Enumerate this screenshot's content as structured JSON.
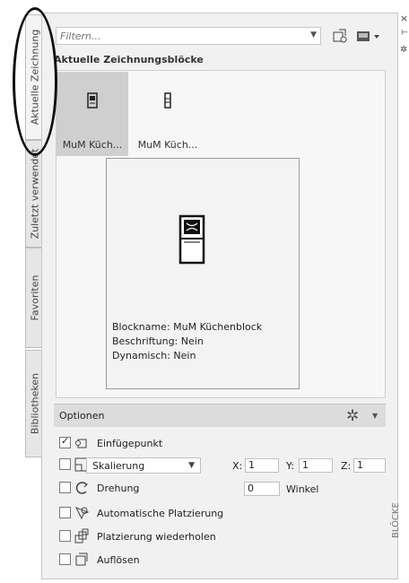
{
  "tabs": [
    {
      "label": "Aktuelle Zeichnung"
    },
    {
      "label": "Zuletzt verwendet"
    },
    {
      "label": "Favoriten"
    },
    {
      "label": "Bibliotheken"
    }
  ],
  "side_strip": {
    "label": "BLÖCKE"
  },
  "filter": {
    "placeholder": "Filtern..."
  },
  "section_title": "Aktuelle Zeichnungsblöcke",
  "blocks": [
    {
      "label": "MuM Küch..."
    },
    {
      "label": "MuM Küch..."
    }
  ],
  "preview": {
    "name_line": "Blockname: MuM Küchenblock",
    "annotative_line": "Beschriftung: Nein",
    "dynamic_line": "Dynamisch: Nein"
  },
  "options": {
    "title": "Optionen",
    "insertion_point": {
      "label": "Einfügepunkt",
      "checked": true
    },
    "scale": {
      "label": "Skalierung",
      "x_label": "X:",
      "x": "1",
      "y_label": "Y:",
      "y": "1",
      "z_label": "Z:",
      "z": "1",
      "checked": false
    },
    "rotation": {
      "label": "Drehung",
      "value": "0",
      "unit": "Winkel",
      "checked": false
    },
    "auto_place": {
      "label": "Automatische Platzierung",
      "checked": false
    },
    "repeat": {
      "label": "Platzierung wiederholen",
      "checked": false
    },
    "explode": {
      "label": "Auflösen",
      "checked": false
    }
  },
  "icons": [
    "close-icon",
    "pin-icon",
    "settings-icon",
    "insert-icon",
    "view-mode-icon",
    "gear-icon"
  ]
}
